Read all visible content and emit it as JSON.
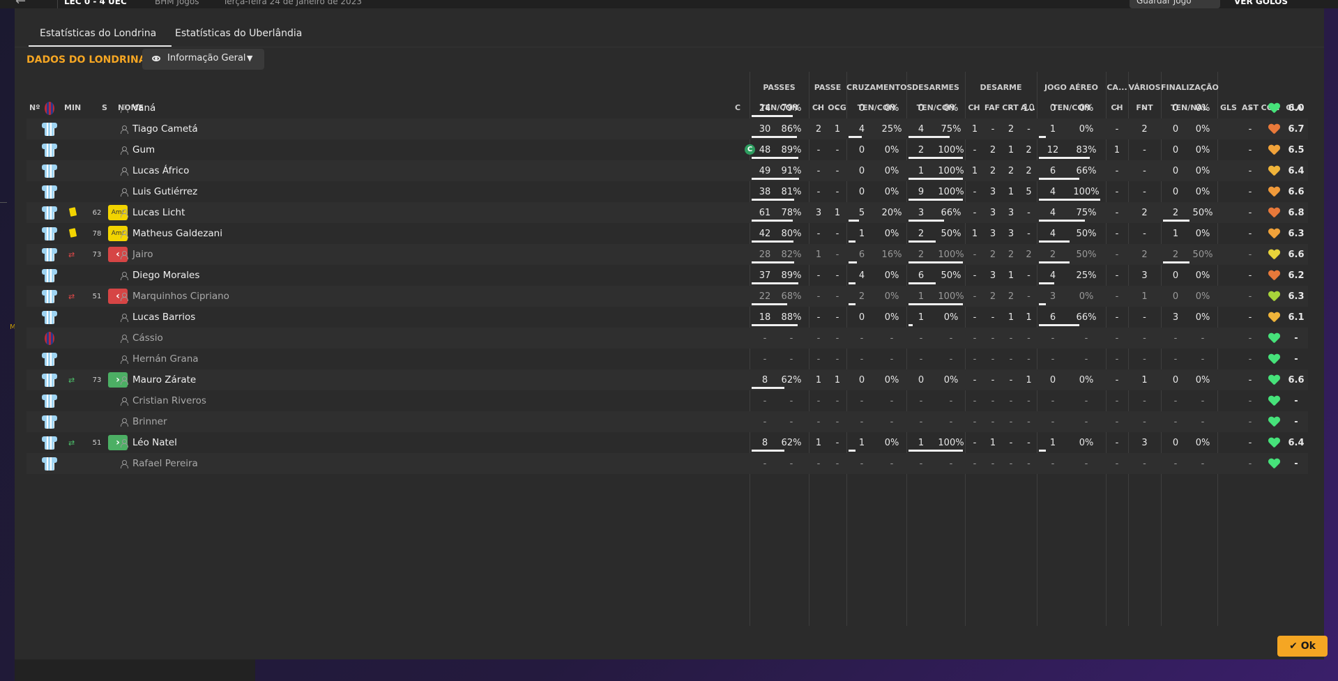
{
  "topbar": {
    "back_icon": "arrow-left-icon",
    "score": "LEC   0 - 4   UEC",
    "competition": "BHM Jogos",
    "date": "Terça-feira 24 de Janeiro de 2023",
    "save_label": "Guardar Jogo",
    "goals_label": "VER GOLOS"
  },
  "tabs": [
    {
      "label": "Estatísticas do Londrina",
      "active": true
    },
    {
      "label": "Estatísticas do Uberlândia",
      "active": false
    }
  ],
  "section_title": "DADOS DO LONDRINA",
  "view_dropdown": {
    "label": "Informação Geral",
    "icon": "eye-icon"
  },
  "group_headers": {
    "passes": "PASSES",
    "passe": "PASSE",
    "cruzamentos": "CRUZAMENTOS",
    "desarmes": "DESARMES",
    "desarme": "DESARME",
    "jogo_aereo": "JOGO AÉREO",
    "ca": "CA...",
    "varios": "VÁRIOS",
    "finalizacao": "FINALIZAÇÃO"
  },
  "columns": {
    "no": "Nº",
    "min": "MIN",
    "s": "S",
    "nome": "NOME",
    "c": "C",
    "passes_tc": "TEN/CON",
    "passe_ch": "CH",
    "passe_ocg": "OCG",
    "cruz_tc": "TEN/CON",
    "des_tc": "TEN/CON",
    "desarme_ch": "CH",
    "desarme_faf": "FAF",
    "desarme_crt": "CRT",
    "desarme_a": "A...",
    "aereo_tc": "TEN/CON",
    "ca_ch": "CH",
    "varios_fnt": "FNT",
    "fin_tn": "TEN/NAL",
    "gls": "GLS",
    "ast": "AST",
    "con": "CON",
    "cla": "CLA"
  },
  "players": [
    {
      "name": "Vaná",
      "gk": true,
      "min": "",
      "card": "",
      "sub": "",
      "badge": "",
      "captain": false,
      "p": [
        "24",
        "79%"
      ],
      "pb": 0.79,
      "ch": "-",
      "ocg": "-",
      "cr": [
        "0",
        "0%"
      ],
      "crb": 0,
      "ds": [
        "0",
        "0%"
      ],
      "dsb": 0,
      "dch": "-",
      "faf": "-",
      "crt": "-",
      "da": "10",
      "ae": [
        "0",
        "0%"
      ],
      "aeb": 0,
      "cach": "-",
      "fnt": "-",
      "fn": [
        "0",
        "0%"
      ],
      "fnb": 0,
      "gls": "",
      "ast": "-",
      "con": "#46e27a",
      "cla": "6.0",
      "dim": false
    },
    {
      "name": "Tiago Cametá",
      "gk": false,
      "min": "",
      "card": "",
      "sub": "",
      "badge": "",
      "captain": false,
      "p": [
        "30",
        "86%"
      ],
      "pb": 0.86,
      "ch": "2",
      "ocg": "1",
      "cr": [
        "4",
        "25%"
      ],
      "crb": 0.25,
      "ds": [
        "4",
        "75%"
      ],
      "dsb": 0.75,
      "dch": "1",
      "faf": "-",
      "crt": "2",
      "da": "-",
      "ae": [
        "1",
        "0%"
      ],
      "aeb": 0,
      "cach": "-",
      "fnt": "2",
      "fn": [
        "0",
        "0%"
      ],
      "fnb": 0,
      "gls": "",
      "ast": "-",
      "con": "#e8793a",
      "cla": "6.7",
      "dim": false
    },
    {
      "name": "Gum",
      "gk": false,
      "min": "",
      "card": "",
      "sub": "",
      "badge": "",
      "captain": true,
      "p": [
        "48",
        "89%"
      ],
      "pb": 0.89,
      "ch": "-",
      "ocg": "-",
      "cr": [
        "0",
        "0%"
      ],
      "crb": 0,
      "ds": [
        "2",
        "100%"
      ],
      "dsb": 1,
      "dch": "-",
      "faf": "2",
      "crt": "1",
      "da": "2",
      "ae": [
        "12",
        "83%"
      ],
      "aeb": 0.83,
      "cach": "1",
      "fnt": "-",
      "fn": [
        "0",
        "0%"
      ],
      "fnb": 0,
      "gls": "",
      "ast": "-",
      "con": "#f0a23a",
      "cla": "6.5",
      "dim": false
    },
    {
      "name": "Lucas Áfrico",
      "gk": false,
      "min": "",
      "card": "",
      "sub": "",
      "badge": "",
      "captain": false,
      "p": [
        "49",
        "91%"
      ],
      "pb": 0.91,
      "ch": "-",
      "ocg": "-",
      "cr": [
        "0",
        "0%"
      ],
      "crb": 0,
      "ds": [
        "1",
        "100%"
      ],
      "dsb": 1,
      "dch": "1",
      "faf": "2",
      "crt": "2",
      "da": "2",
      "ae": [
        "6",
        "66%"
      ],
      "aeb": 0.66,
      "cach": "-",
      "fnt": "-",
      "fn": [
        "0",
        "0%"
      ],
      "fnb": 0,
      "gls": "",
      "ast": "-",
      "con": "#f0b43a",
      "cla": "6.4",
      "dim": false
    },
    {
      "name": "Luis Gutiérrez",
      "gk": false,
      "min": "",
      "card": "",
      "sub": "",
      "badge": "",
      "captain": false,
      "p": [
        "38",
        "81%"
      ],
      "pb": 0.81,
      "ch": "-",
      "ocg": "-",
      "cr": [
        "0",
        "0%"
      ],
      "crb": 0,
      "ds": [
        "9",
        "100%"
      ],
      "dsb": 1,
      "dch": "-",
      "faf": "3",
      "crt": "1",
      "da": "5",
      "ae": [
        "4",
        "100%"
      ],
      "aeb": 1,
      "cach": "-",
      "fnt": "-",
      "fn": [
        "0",
        "0%"
      ],
      "fnb": 0,
      "gls": "",
      "ast": "-",
      "con": "#f09a3a",
      "cla": "6.6",
      "dim": false
    },
    {
      "name": "Lucas Licht",
      "gk": false,
      "min": "62",
      "card": "yellow",
      "sub": "",
      "badge": "Amr",
      "captain": false,
      "p": [
        "61",
        "78%"
      ],
      "pb": 0.78,
      "ch": "3",
      "ocg": "1",
      "cr": [
        "5",
        "20%"
      ],
      "crb": 0.2,
      "ds": [
        "3",
        "66%"
      ],
      "dsb": 0.66,
      "dch": "-",
      "faf": "3",
      "crt": "3",
      "da": "-",
      "ae": [
        "4",
        "75%"
      ],
      "aeb": 0.75,
      "cach": "-",
      "fnt": "2",
      "fn": [
        "2",
        "50%"
      ],
      "fnb": 0.5,
      "gls": "",
      "ast": "-",
      "con": "#e8793a",
      "cla": "6.8",
      "dim": false
    },
    {
      "name": "Matheus Galdezani",
      "gk": false,
      "min": "78",
      "card": "yellow",
      "sub": "",
      "badge": "Amr",
      "captain": false,
      "p": [
        "42",
        "80%"
      ],
      "pb": 0.8,
      "ch": "-",
      "ocg": "-",
      "cr": [
        "1",
        "0%"
      ],
      "crb": 0,
      "ds": [
        "2",
        "50%"
      ],
      "dsb": 0.5,
      "dch": "1",
      "faf": "3",
      "crt": "3",
      "da": "-",
      "ae": [
        "4",
        "50%"
      ],
      "aeb": 0.5,
      "cach": "-",
      "fnt": "-",
      "fn": [
        "1",
        "0%"
      ],
      "fnb": 0,
      "gls": "",
      "ast": "-",
      "con": "#f0a23a",
      "cla": "6.3",
      "dim": false
    },
    {
      "name": "Jairo",
      "gk": false,
      "min": "73",
      "card": "",
      "sub": "out",
      "badge": "‹",
      "captain": false,
      "p": [
        "28",
        "82%"
      ],
      "pb": 0.82,
      "ch": "1",
      "ocg": "-",
      "cr": [
        "6",
        "16%"
      ],
      "crb": 0.16,
      "ds": [
        "2",
        "100%"
      ],
      "dsb": 1,
      "dch": "-",
      "faf": "2",
      "crt": "2",
      "da": "2",
      "ae": [
        "2",
        "50%"
      ],
      "aeb": 0.5,
      "cach": "-",
      "fnt": "2",
      "fn": [
        "2",
        "50%"
      ],
      "fnb": 0.5,
      "gls": "",
      "ast": "-",
      "con": "#e8d43a",
      "cla": "6.6",
      "dim": true
    },
    {
      "name": "Diego Morales",
      "gk": false,
      "min": "",
      "card": "",
      "sub": "",
      "badge": "",
      "captain": false,
      "p": [
        "37",
        "89%"
      ],
      "pb": 0.89,
      "ch": "-",
      "ocg": "-",
      "cr": [
        "4",
        "0%"
      ],
      "crb": 0,
      "ds": [
        "6",
        "50%"
      ],
      "dsb": 0.5,
      "dch": "-",
      "faf": "3",
      "crt": "1",
      "da": "-",
      "ae": [
        "4",
        "25%"
      ],
      "aeb": 0.25,
      "cach": "-",
      "fnt": "3",
      "fn": [
        "0",
        "0%"
      ],
      "fnb": 0,
      "gls": "",
      "ast": "-",
      "con": "#e8793a",
      "cla": "6.2",
      "dim": false
    },
    {
      "name": "Marquinhos Cipriano",
      "gk": false,
      "min": "51",
      "card": "",
      "sub": "out",
      "badge": "‹",
      "captain": false,
      "p": [
        "22",
        "68%"
      ],
      "pb": 0.68,
      "ch": "-",
      "ocg": "-",
      "cr": [
        "2",
        "0%"
      ],
      "crb": 0,
      "ds": [
        "1",
        "100%"
      ],
      "dsb": 1,
      "dch": "-",
      "faf": "2",
      "crt": "2",
      "da": "-",
      "ae": [
        "3",
        "0%"
      ],
      "aeb": 0,
      "cach": "-",
      "fnt": "1",
      "fn": [
        "0",
        "0%"
      ],
      "fnb": 0,
      "gls": "",
      "ast": "-",
      "con": "#a8d43a",
      "cla": "6.3",
      "dim": true
    },
    {
      "name": "Lucas Barrios",
      "gk": false,
      "min": "",
      "card": "",
      "sub": "",
      "badge": "",
      "captain": false,
      "p": [
        "18",
        "88%"
      ],
      "pb": 0.88,
      "ch": "-",
      "ocg": "-",
      "cr": [
        "0",
        "0%"
      ],
      "crb": 0,
      "ds": [
        "1",
        "0%"
      ],
      "dsb": 0,
      "dch": "-",
      "faf": "-",
      "crt": "1",
      "da": "1",
      "ae": [
        "6",
        "66%"
      ],
      "aeb": 0.66,
      "cach": "-",
      "fnt": "-",
      "fn": [
        "3",
        "0%"
      ],
      "fnb": 0,
      "gls": "",
      "ast": "-",
      "con": "#f0b43a",
      "cla": "6.1",
      "dim": false
    },
    {
      "name": "Cássio",
      "gk": true,
      "min": "",
      "card": "",
      "sub": "",
      "badge": "",
      "captain": false,
      "p": [
        "-",
        "-"
      ],
      "pb": 0,
      "ch": "-",
      "ocg": "-",
      "cr": [
        "-",
        "-"
      ],
      "crb": 0,
      "ds": [
        "-",
        "-"
      ],
      "dsb": 0,
      "dch": "-",
      "faf": "-",
      "crt": "-",
      "da": "-",
      "ae": [
        "-",
        "-"
      ],
      "aeb": 0,
      "cach": "-",
      "fnt": "-",
      "fn": [
        "-",
        "-"
      ],
      "fnb": 0,
      "gls": "",
      "ast": "-",
      "con": "#46e27a",
      "cla": "-",
      "dim": true
    },
    {
      "name": "Hernán Grana",
      "gk": false,
      "min": "",
      "card": "",
      "sub": "",
      "badge": "",
      "captain": false,
      "p": [
        "-",
        "-"
      ],
      "pb": 0,
      "ch": "-",
      "ocg": "-",
      "cr": [
        "-",
        "-"
      ],
      "crb": 0,
      "ds": [
        "-",
        "-"
      ],
      "dsb": 0,
      "dch": "-",
      "faf": "-",
      "crt": "-",
      "da": "-",
      "ae": [
        "-",
        "-"
      ],
      "aeb": 0,
      "cach": "-",
      "fnt": "-",
      "fn": [
        "-",
        "-"
      ],
      "fnb": 0,
      "gls": "",
      "ast": "-",
      "con": "#46e27a",
      "cla": "-",
      "dim": true
    },
    {
      "name": "Mauro Zárate",
      "gk": false,
      "min": "73",
      "card": "",
      "sub": "in",
      "badge": "›",
      "captain": false,
      "p": [
        "8",
        "62%"
      ],
      "pb": 0.62,
      "ch": "1",
      "ocg": "1",
      "cr": [
        "0",
        "0%"
      ],
      "crb": 0,
      "ds": [
        "0",
        "0%"
      ],
      "dsb": 0,
      "dch": "-",
      "faf": "-",
      "crt": "-",
      "da": "1",
      "ae": [
        "0",
        "0%"
      ],
      "aeb": 0,
      "cach": "-",
      "fnt": "1",
      "fn": [
        "0",
        "0%"
      ],
      "fnb": 0,
      "gls": "",
      "ast": "-",
      "con": "#46e27a",
      "cla": "6.6",
      "dim": false
    },
    {
      "name": "Cristian Riveros",
      "gk": false,
      "min": "",
      "card": "",
      "sub": "",
      "badge": "",
      "captain": false,
      "p": [
        "-",
        "-"
      ],
      "pb": 0,
      "ch": "-",
      "ocg": "-",
      "cr": [
        "-",
        "-"
      ],
      "crb": 0,
      "ds": [
        "-",
        "-"
      ],
      "dsb": 0,
      "dch": "-",
      "faf": "-",
      "crt": "-",
      "da": "-",
      "ae": [
        "-",
        "-"
      ],
      "aeb": 0,
      "cach": "-",
      "fnt": "-",
      "fn": [
        "-",
        "-"
      ],
      "fnb": 0,
      "gls": "",
      "ast": "-",
      "con": "#46e27a",
      "cla": "-",
      "dim": true
    },
    {
      "name": "Brinner",
      "gk": false,
      "min": "",
      "card": "",
      "sub": "",
      "badge": "",
      "captain": false,
      "p": [
        "-",
        "-"
      ],
      "pb": 0,
      "ch": "-",
      "ocg": "-",
      "cr": [
        "-",
        "-"
      ],
      "crb": 0,
      "ds": [
        "-",
        "-"
      ],
      "dsb": 0,
      "dch": "-",
      "faf": "-",
      "crt": "-",
      "da": "-",
      "ae": [
        "-",
        "-"
      ],
      "aeb": 0,
      "cach": "-",
      "fnt": "-",
      "fn": [
        "-",
        "-"
      ],
      "fnb": 0,
      "gls": "",
      "ast": "-",
      "con": "#46e27a",
      "cla": "-",
      "dim": true
    },
    {
      "name": "Léo Natel",
      "gk": false,
      "min": "51",
      "card": "",
      "sub": "in",
      "badge": "›",
      "captain": false,
      "p": [
        "8",
        "62%"
      ],
      "pb": 0.62,
      "ch": "1",
      "ocg": "-",
      "cr": [
        "1",
        "0%"
      ],
      "crb": 0,
      "ds": [
        "1",
        "100%"
      ],
      "dsb": 1,
      "dch": "-",
      "faf": "1",
      "crt": "-",
      "da": "-",
      "ae": [
        "1",
        "0%"
      ],
      "aeb": 0,
      "cach": "-",
      "fnt": "3",
      "fn": [
        "0",
        "0%"
      ],
      "fnb": 0,
      "gls": "",
      "ast": "-",
      "con": "#46e27a",
      "cla": "6.4",
      "dim": false
    },
    {
      "name": "Rafael Pereira",
      "gk": false,
      "min": "",
      "card": "",
      "sub": "",
      "badge": "",
      "captain": false,
      "p": [
        "-",
        "-"
      ],
      "pb": 0,
      "ch": "-",
      "ocg": "-",
      "cr": [
        "-",
        "-"
      ],
      "crb": 0,
      "ds": [
        "-",
        "-"
      ],
      "dsb": 0,
      "dch": "-",
      "faf": "-",
      "crt": "-",
      "da": "-",
      "ae": [
        "-",
        "-"
      ],
      "aeb": 0,
      "cach": "-",
      "fnt": "-",
      "fn": [
        "-",
        "-"
      ],
      "fnb": 0,
      "gls": "",
      "ast": "-",
      "con": "#46e27a",
      "cla": "-",
      "dim": true
    }
  ],
  "ok_label": "Ok"
}
